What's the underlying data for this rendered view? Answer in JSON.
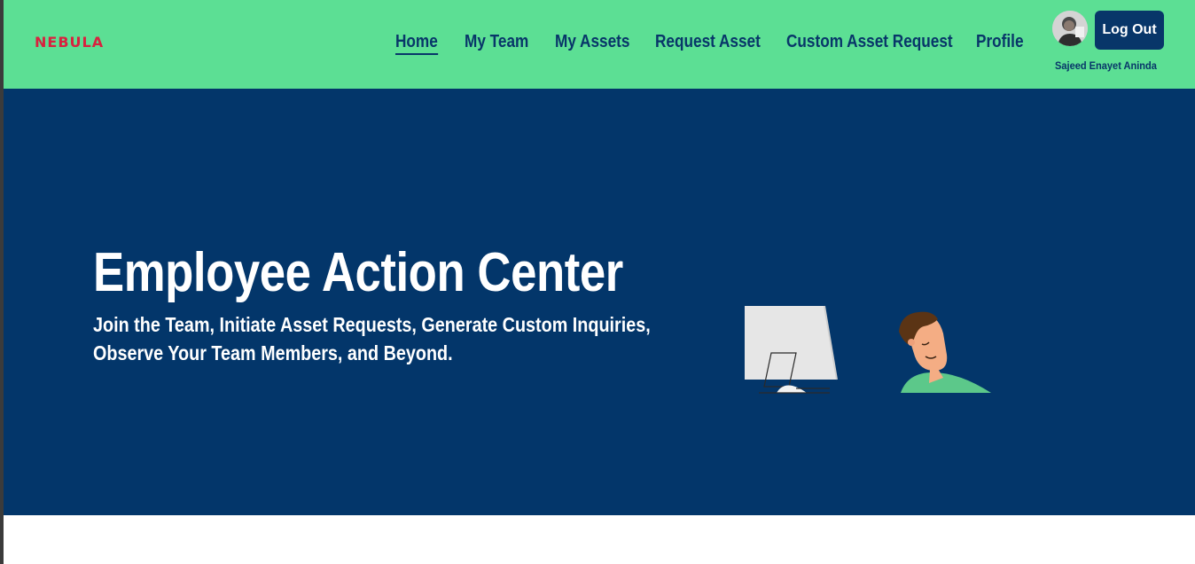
{
  "brand": {
    "logo_text": "NEBULA"
  },
  "nav": {
    "items": [
      {
        "label": "Home",
        "active": true
      },
      {
        "label": "My Team"
      },
      {
        "label": "My Assets"
      },
      {
        "label": "Request Asset"
      },
      {
        "label": "Custom Asset Request"
      },
      {
        "label": "Profile"
      }
    ]
  },
  "user": {
    "name": "Sajeed Enayet Aninda",
    "logout_label": "Log Out"
  },
  "hero": {
    "title": "Employee Action Center",
    "subtitle_line1": "Join the Team, Initiate Asset Requests, Generate Custom Inquiries,",
    "subtitle_line2": "Observe Your Team Members, and Beyond."
  },
  "colors": {
    "navbar_bg": "#5cdf94",
    "nav_text": "#083669",
    "hero_bg": "#03366a",
    "logo": "#d8223f",
    "button_bg": "#083669"
  },
  "icons": {
    "avatar": "user-avatar-photo",
    "illustration": "man-at-computer-illustration"
  }
}
